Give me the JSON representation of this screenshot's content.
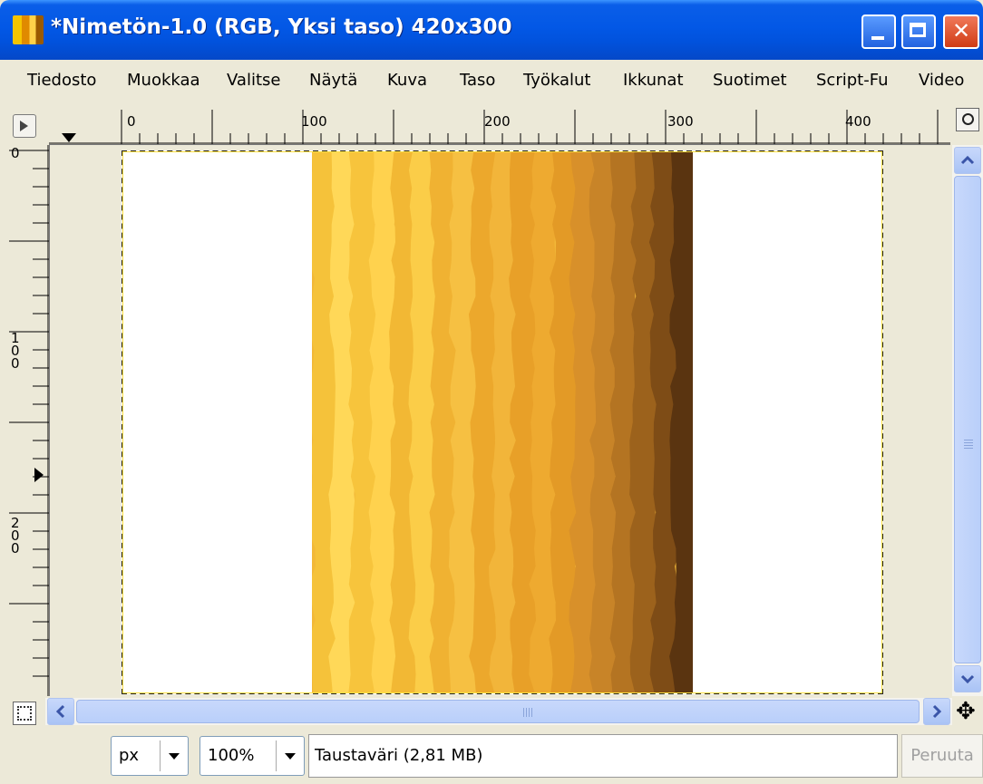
{
  "window": {
    "title": "*Nimetön-1.0 (RGB, Yksi taso) 420x300",
    "close_glyph": "✕"
  },
  "menu": [
    "Tiedosto",
    "Muokkaa",
    "Valitse",
    "Näytä",
    "Kuva",
    "Taso",
    "Työkalut",
    "Ikkunat",
    "Suotimet",
    "Script-Fu",
    "Video"
  ],
  "rulers": {
    "horizontal_labels": [
      "0",
      "100",
      "200",
      "300",
      "400"
    ],
    "vertical_labels": [
      "0",
      "1\n0\n0",
      "2\n0\n0"
    ]
  },
  "canvas": {
    "wood_colors": [
      "#f5c23a",
      "#ffd858",
      "#f7c43c",
      "#ffd24e",
      "#f2b834",
      "#fbcd48",
      "#f0b232",
      "#f6c042",
      "#eca82c",
      "#f2b53a",
      "#e8a028",
      "#eeaa30",
      "#e39a26",
      "#d8902a",
      "#c88428",
      "#b47422",
      "#9c621c",
      "#7e4c16",
      "#5a3410"
    ]
  },
  "status": {
    "unit": "px",
    "zoom": "100%",
    "message": "Taustaväri (2,81 MB)",
    "cancel_label": "Peruuta"
  },
  "icons": {
    "nav_cross": "✥"
  }
}
